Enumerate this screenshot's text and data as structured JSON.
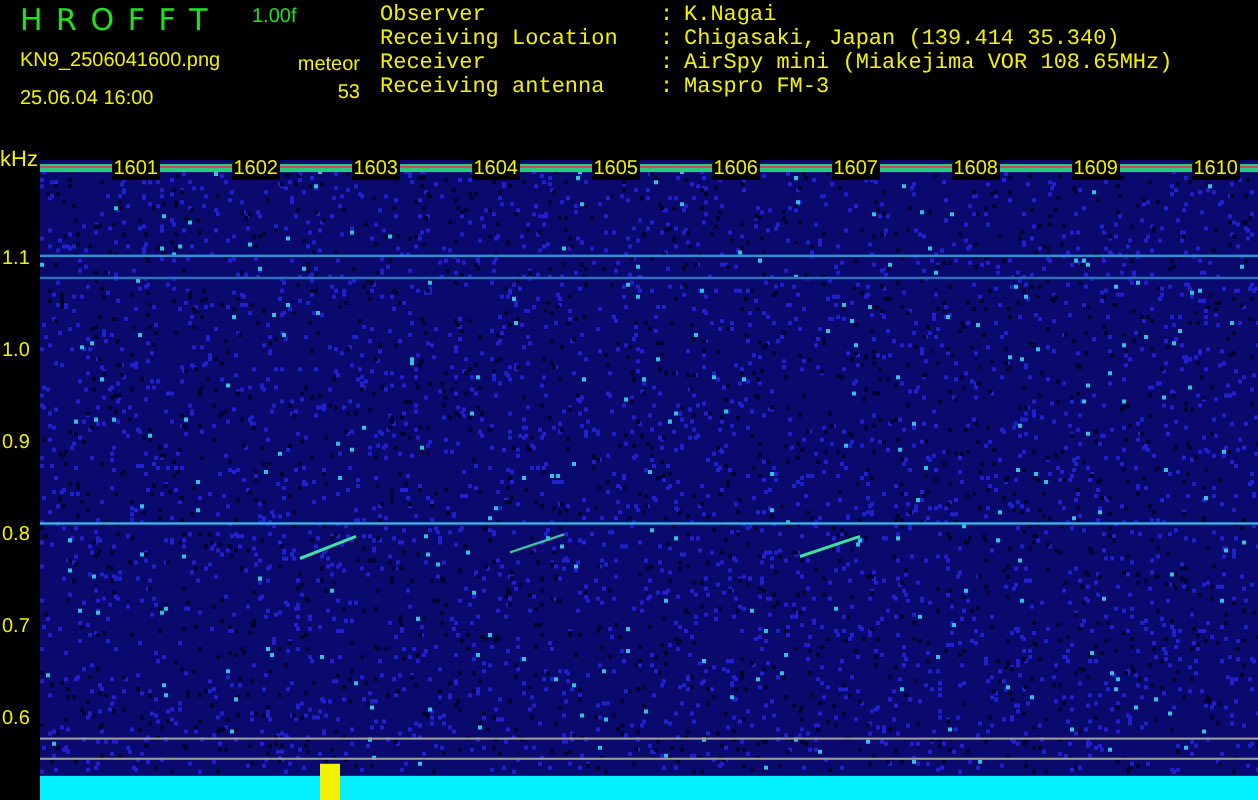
{
  "header": {
    "title": "H R O F F T",
    "version": "1.00f",
    "filename": "KN9_2506041600.png",
    "datetime": "25.06.04 16:00",
    "count_label": "meteor",
    "count": "53"
  },
  "info": [
    {
      "label": "Observer",
      "separator": ":",
      "value": "K.Nagai"
    },
    {
      "label": "Receiving Location",
      "separator": ":",
      "value": "Chigasaki, Japan (139.414 35.340)"
    },
    {
      "label": "Receiver",
      "separator": ":",
      "value": "AirSpy mini (Miakejima VOR 108.65MHz)"
    },
    {
      "label": "Receiving antenna",
      "separator": ":",
      "value": "Maspro FM-3"
    }
  ],
  "spectrogram": {
    "unit": "kHz",
    "y_labels": [
      "1.1",
      "1.0",
      "0.9",
      "0.8",
      "0.7",
      "0.6"
    ],
    "time_labels": [
      "1601",
      "1602",
      "1603",
      "1604",
      "1605",
      "1606",
      "1607",
      "1608",
      "1609",
      "1610"
    ]
  }
}
